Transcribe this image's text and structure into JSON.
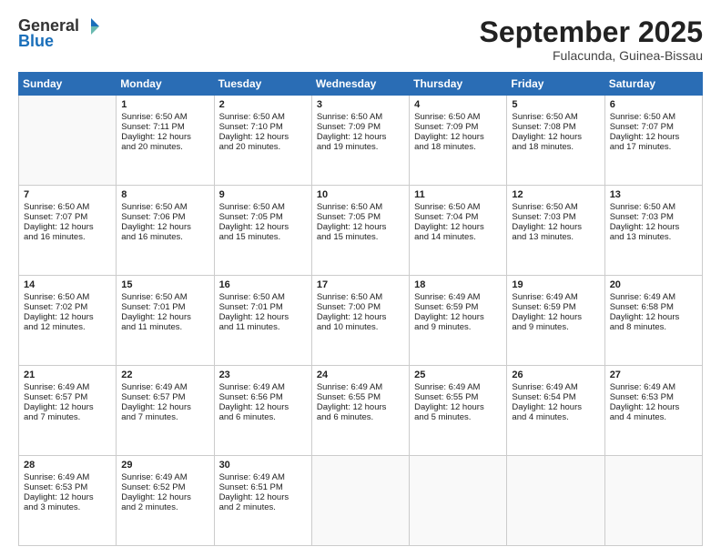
{
  "header": {
    "logo_general": "General",
    "logo_blue": "Blue",
    "month_title": "September 2025",
    "location": "Fulacunda, Guinea-Bissau"
  },
  "weekdays": [
    "Sunday",
    "Monday",
    "Tuesday",
    "Wednesday",
    "Thursday",
    "Friday",
    "Saturday"
  ],
  "weeks": [
    [
      {
        "day": "",
        "lines": []
      },
      {
        "day": "1",
        "lines": [
          "Sunrise: 6:50 AM",
          "Sunset: 7:11 PM",
          "Daylight: 12 hours",
          "and 20 minutes."
        ]
      },
      {
        "day": "2",
        "lines": [
          "Sunrise: 6:50 AM",
          "Sunset: 7:10 PM",
          "Daylight: 12 hours",
          "and 20 minutes."
        ]
      },
      {
        "day": "3",
        "lines": [
          "Sunrise: 6:50 AM",
          "Sunset: 7:09 PM",
          "Daylight: 12 hours",
          "and 19 minutes."
        ]
      },
      {
        "day": "4",
        "lines": [
          "Sunrise: 6:50 AM",
          "Sunset: 7:09 PM",
          "Daylight: 12 hours",
          "and 18 minutes."
        ]
      },
      {
        "day": "5",
        "lines": [
          "Sunrise: 6:50 AM",
          "Sunset: 7:08 PM",
          "Daylight: 12 hours",
          "and 18 minutes."
        ]
      },
      {
        "day": "6",
        "lines": [
          "Sunrise: 6:50 AM",
          "Sunset: 7:07 PM",
          "Daylight: 12 hours",
          "and 17 minutes."
        ]
      }
    ],
    [
      {
        "day": "7",
        "lines": [
          "Sunrise: 6:50 AM",
          "Sunset: 7:07 PM",
          "Daylight: 12 hours",
          "and 16 minutes."
        ]
      },
      {
        "day": "8",
        "lines": [
          "Sunrise: 6:50 AM",
          "Sunset: 7:06 PM",
          "Daylight: 12 hours",
          "and 16 minutes."
        ]
      },
      {
        "day": "9",
        "lines": [
          "Sunrise: 6:50 AM",
          "Sunset: 7:05 PM",
          "Daylight: 12 hours",
          "and 15 minutes."
        ]
      },
      {
        "day": "10",
        "lines": [
          "Sunrise: 6:50 AM",
          "Sunset: 7:05 PM",
          "Daylight: 12 hours",
          "and 15 minutes."
        ]
      },
      {
        "day": "11",
        "lines": [
          "Sunrise: 6:50 AM",
          "Sunset: 7:04 PM",
          "Daylight: 12 hours",
          "and 14 minutes."
        ]
      },
      {
        "day": "12",
        "lines": [
          "Sunrise: 6:50 AM",
          "Sunset: 7:03 PM",
          "Daylight: 12 hours",
          "and 13 minutes."
        ]
      },
      {
        "day": "13",
        "lines": [
          "Sunrise: 6:50 AM",
          "Sunset: 7:03 PM",
          "Daylight: 12 hours",
          "and 13 minutes."
        ]
      }
    ],
    [
      {
        "day": "14",
        "lines": [
          "Sunrise: 6:50 AM",
          "Sunset: 7:02 PM",
          "Daylight: 12 hours",
          "and 12 minutes."
        ]
      },
      {
        "day": "15",
        "lines": [
          "Sunrise: 6:50 AM",
          "Sunset: 7:01 PM",
          "Daylight: 12 hours",
          "and 11 minutes."
        ]
      },
      {
        "day": "16",
        "lines": [
          "Sunrise: 6:50 AM",
          "Sunset: 7:01 PM",
          "Daylight: 12 hours",
          "and 11 minutes."
        ]
      },
      {
        "day": "17",
        "lines": [
          "Sunrise: 6:50 AM",
          "Sunset: 7:00 PM",
          "Daylight: 12 hours",
          "and 10 minutes."
        ]
      },
      {
        "day": "18",
        "lines": [
          "Sunrise: 6:49 AM",
          "Sunset: 6:59 PM",
          "Daylight: 12 hours",
          "and 9 minutes."
        ]
      },
      {
        "day": "19",
        "lines": [
          "Sunrise: 6:49 AM",
          "Sunset: 6:59 PM",
          "Daylight: 12 hours",
          "and 9 minutes."
        ]
      },
      {
        "day": "20",
        "lines": [
          "Sunrise: 6:49 AM",
          "Sunset: 6:58 PM",
          "Daylight: 12 hours",
          "and 8 minutes."
        ]
      }
    ],
    [
      {
        "day": "21",
        "lines": [
          "Sunrise: 6:49 AM",
          "Sunset: 6:57 PM",
          "Daylight: 12 hours",
          "and 7 minutes."
        ]
      },
      {
        "day": "22",
        "lines": [
          "Sunrise: 6:49 AM",
          "Sunset: 6:57 PM",
          "Daylight: 12 hours",
          "and 7 minutes."
        ]
      },
      {
        "day": "23",
        "lines": [
          "Sunrise: 6:49 AM",
          "Sunset: 6:56 PM",
          "Daylight: 12 hours",
          "and 6 minutes."
        ]
      },
      {
        "day": "24",
        "lines": [
          "Sunrise: 6:49 AM",
          "Sunset: 6:55 PM",
          "Daylight: 12 hours",
          "and 6 minutes."
        ]
      },
      {
        "day": "25",
        "lines": [
          "Sunrise: 6:49 AM",
          "Sunset: 6:55 PM",
          "Daylight: 12 hours",
          "and 5 minutes."
        ]
      },
      {
        "day": "26",
        "lines": [
          "Sunrise: 6:49 AM",
          "Sunset: 6:54 PM",
          "Daylight: 12 hours",
          "and 4 minutes."
        ]
      },
      {
        "day": "27",
        "lines": [
          "Sunrise: 6:49 AM",
          "Sunset: 6:53 PM",
          "Daylight: 12 hours",
          "and 4 minutes."
        ]
      }
    ],
    [
      {
        "day": "28",
        "lines": [
          "Sunrise: 6:49 AM",
          "Sunset: 6:53 PM",
          "Daylight: 12 hours",
          "and 3 minutes."
        ]
      },
      {
        "day": "29",
        "lines": [
          "Sunrise: 6:49 AM",
          "Sunset: 6:52 PM",
          "Daylight: 12 hours",
          "and 2 minutes."
        ]
      },
      {
        "day": "30",
        "lines": [
          "Sunrise: 6:49 AM",
          "Sunset: 6:51 PM",
          "Daylight: 12 hours",
          "and 2 minutes."
        ]
      },
      {
        "day": "",
        "lines": []
      },
      {
        "day": "",
        "lines": []
      },
      {
        "day": "",
        "lines": []
      },
      {
        "day": "",
        "lines": []
      }
    ]
  ]
}
